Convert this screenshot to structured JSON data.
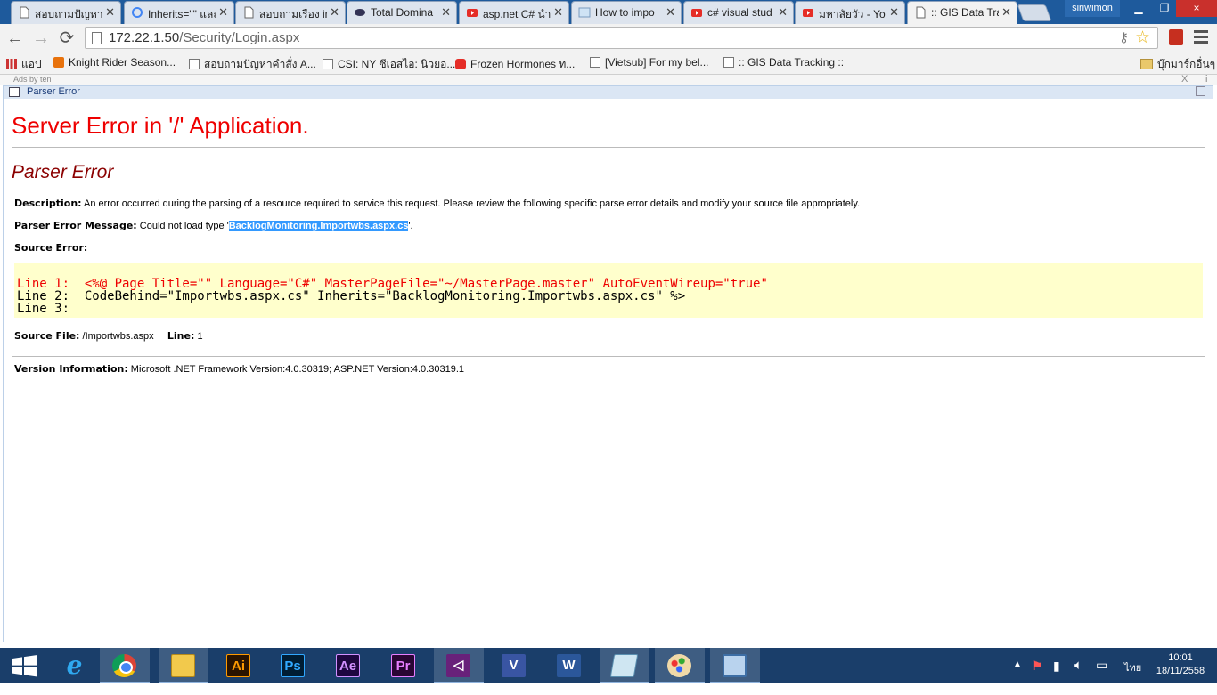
{
  "tabs": [
    {
      "title": "สอบถามปัญหาเรื่อง",
      "icon": "page-icon"
    },
    {
      "title": "Inherits=\"\" และ",
      "icon": "google-icon"
    },
    {
      "title": "สอบถามเรื่อง in",
      "icon": "page-icon"
    },
    {
      "title": "Total Domina",
      "icon": "forum-icon"
    },
    {
      "title": "asp.net C# นำ",
      "icon": "youtube-icon"
    },
    {
      "title": "How to impo",
      "icon": "image-icon"
    },
    {
      "title": "c# visual stud",
      "icon": "youtube-icon"
    },
    {
      "title": "มหาลัยวัว - You",
      "icon": "youtube-icon"
    },
    {
      "title": ":: GIS Data Tra",
      "icon": "page-icon"
    }
  ],
  "window": {
    "user": "siriwimon",
    "close": "×"
  },
  "toolbar": {
    "back": "←",
    "forward": "→",
    "reload": "⟳",
    "url_host": "172.22.1.50",
    "url_path": "/Security/Login.aspx"
  },
  "bookmarks": [
    {
      "label": "แอป",
      "icon": "apps-icon"
    },
    {
      "label": "Knight Rider Season...",
      "icon": "bookmark-site-icon"
    },
    {
      "label": "สอบถามปัญหาคำสั่ง A...",
      "icon": "page-icon"
    },
    {
      "label": "CSI: NY ซีเอสไอ: นิวยอ...",
      "icon": "page-icon"
    },
    {
      "label": "Frozen Hormones ท...",
      "icon": "youtube-icon"
    },
    {
      "label": "[Vietsub] For my bel...",
      "icon": "page-icon"
    },
    {
      "label": ":: GIS Data Tracking ::",
      "icon": "page-icon"
    }
  ],
  "other_bookmarks": "บุ๊กมาร์กอื่นๆ",
  "ads": {
    "label": "Ads by ten",
    "close": "X",
    "info": "i"
  },
  "frame_title": "Parser Error",
  "error": {
    "heading": "Server Error in '/' Application.",
    "subheading": "Parser Error",
    "description_label": "Description:",
    "description": "An error occurred during the parsing of a resource required to service this request. Please review the following specific parse error details and modify your source file appropriately.",
    "message_label": "Parser Error Message:",
    "message_prefix": "Could not load type '",
    "message_type": "BacklogMonitoring.Importwbs.aspx.cs",
    "message_suffix": "'.",
    "source_error_label": "Source Error:",
    "code_lines": [
      "Line 1:  <%@ Page Title=\"\" Language=\"C#\" MasterPageFile=\"~/MasterPage.master\" AutoEventWireup=\"true\"",
      "Line 2:  CodeBehind=\"Importwbs.aspx.cs\" Inherits=\"BacklogMonitoring.Importwbs.aspx.cs\" %>",
      "Line 3:"
    ],
    "source_file_label": "Source File:",
    "source_file": "/Importwbs.aspx",
    "line_label": "Line:",
    "line": "1",
    "version_label": "Version Information:",
    "version": "Microsoft .NET Framework Version:4.0.30319; ASP.NET Version:4.0.30319.1"
  },
  "taskbar": {
    "apps": [
      {
        "name": "start-button",
        "label": ""
      },
      {
        "name": "ie-icon",
        "label": "e"
      },
      {
        "name": "chrome-icon",
        "label": ""
      },
      {
        "name": "file-explorer-icon",
        "label": ""
      },
      {
        "name": "illustrator-icon",
        "label": "Ai"
      },
      {
        "name": "photoshop-icon",
        "label": "Ps"
      },
      {
        "name": "after-effects-icon",
        "label": "Ae"
      },
      {
        "name": "premiere-icon",
        "label": "Pr"
      },
      {
        "name": "visual-studio-icon",
        "label": ""
      },
      {
        "name": "visio-icon",
        "label": "V"
      },
      {
        "name": "word-icon",
        "label": "W"
      },
      {
        "name": "notepad-icon",
        "label": ""
      },
      {
        "name": "paint-icon",
        "label": ""
      },
      {
        "name": "remote-desktop-icon",
        "label": ""
      }
    ],
    "lang": "ไทย",
    "time": "10:01",
    "date": "18/11/2558"
  }
}
